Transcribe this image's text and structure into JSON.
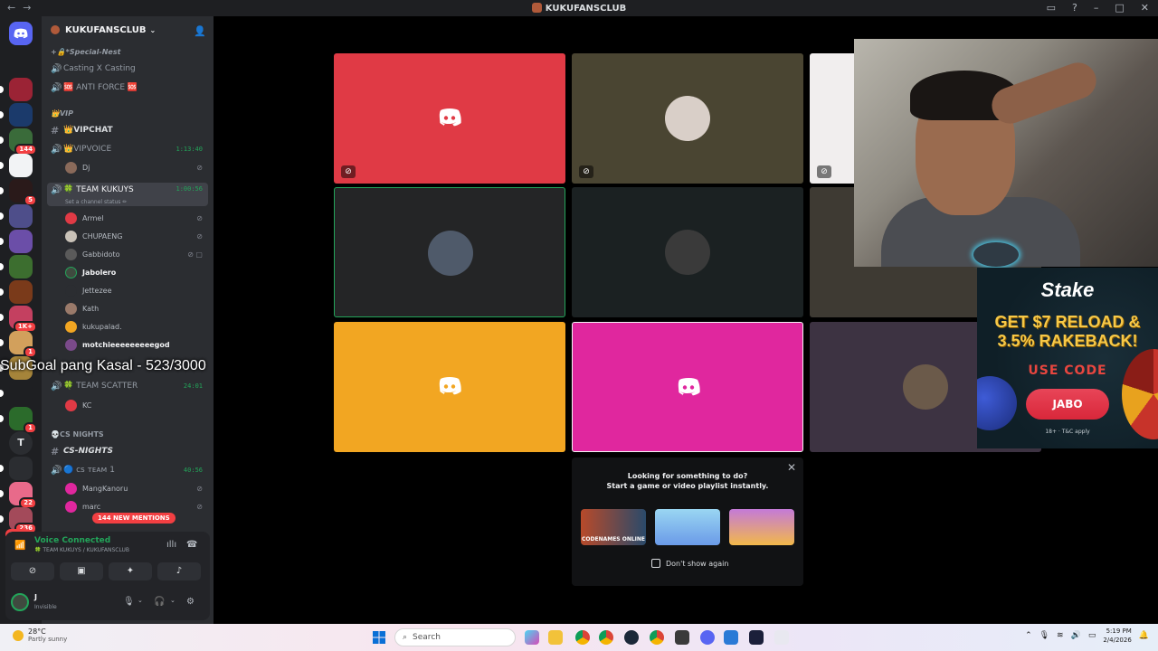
{
  "titlebar": {
    "title": "KUKUFANSCLUB",
    "back_glyph": "←",
    "forward_glyph": "→",
    "icons": [
      "inbox-icon",
      "help-icon",
      "minimize-icon",
      "maximize-icon",
      "close-icon"
    ]
  },
  "server_rail": {
    "servers": [
      {
        "color": "#5865f2",
        "badge": ""
      },
      {
        "color": "#9b2335",
        "badge": ""
      },
      {
        "color": "#1b3a6b",
        "badge": ""
      },
      {
        "color": "#3a6b3a",
        "badge": "144"
      },
      {
        "color": "#f2f3f5",
        "badge": ""
      },
      {
        "color": "#2a1a1a",
        "badge": "5"
      },
      {
        "color": "#4e4e8a",
        "badge": ""
      },
      {
        "color": "#6b4ea8",
        "badge": ""
      },
      {
        "color": "#3c6e2f",
        "badge": ""
      },
      {
        "color": "#7a3a1a",
        "badge": ""
      },
      {
        "color": "#c44060",
        "badge": "1K+"
      },
      {
        "color": "#d2a05c",
        "badge": "1"
      },
      {
        "color": "#a5843a",
        "badge": ""
      },
      {
        "color": "#1e1f22",
        "badge": ""
      },
      {
        "color": "#2b6b2b",
        "badge": "1"
      },
      {
        "color": "#2b2d31",
        "badge": ""
      },
      {
        "color": "#e86a8a",
        "badge": "22"
      },
      {
        "color": "#a34a5a",
        "badge": "236"
      }
    ],
    "letter_server": "T",
    "new_label": "NEW"
  },
  "guild": {
    "name": "KUKUFANSCLUB",
    "categories": {
      "special": "+🔒*Special-Nest",
      "vip": "👑VIP",
      "csnights": "💀CS NIGHTS"
    },
    "channels": {
      "casting": "Casting X Casting",
      "antiforce": "🆘 ANTI FORCE 🆘",
      "vipchat": "👑VIPCHAT",
      "vipvoice": "👑VIPVOICE",
      "vipvoice_time": "1:13:40",
      "teamkukuys": "🍀 TEAM KUKUYS",
      "teamkukuys_time": "1:00:56",
      "teamkukuys_status": "Set a channel status ✏",
      "teamscatter": "🍀 TEAM SCATTER",
      "teamscatter_time": "24:01",
      "csnights": "CS-NIGHTS",
      "csteam": "🔵 ᴄs ᴛᴇᴀᴍ 1",
      "csteam_time": "40:56"
    },
    "users": {
      "dj": "Dj",
      "armel": "Armel",
      "chupaeng": "CHUPAENG",
      "gabbidoto": "Gabbidoto",
      "jabolero": "Jabolero",
      "jettezee": "Jettezee",
      "kath": "Kath",
      "kukupalad": "kukupalad.",
      "motchie": "motchieeeeeeeeegod",
      "kc": "KC",
      "mangkanoru": "MangKanoru",
      "marc": "marc"
    },
    "mentions": "144 NEW MENTIONS"
  },
  "overlay_text": "SubGoal pang Kasal - 523/3000",
  "voice_panel": {
    "status": "Voice Connected",
    "channel": "🍀 TEAM KUKUYS / KUKUFANSCLUB",
    "user_name": "J",
    "user_status": "Invisible"
  },
  "activity": {
    "line1": "Looking for something to do?",
    "line2": "Start a game or video playlist instantly.",
    "games": [
      "CODENAMES ONLINE",
      "",
      ""
    ],
    "dont_show": "Don't show again"
  },
  "promo": {
    "brand": "Stake",
    "headline1": "GET $7 RELOAD &",
    "headline2": "3.5% RAKEBACK!",
    "use_code": "USE CODE",
    "code": "JABO",
    "terms": "18+ · T&C apply"
  },
  "taskbar": {
    "temp": "28°C",
    "weather": "Partly sunny",
    "search_placeholder": "Search",
    "time": "5:19 PM",
    "date": "2/4/2026"
  },
  "colors": {
    "tile_red": "#e03a45",
    "tile_olive": "#4a4532",
    "tile_dark1": "#242526",
    "tile_dark2": "#1b2122",
    "tile_brown": "#3e3a33",
    "tile_orange": "#f2a622",
    "tile_pink": "#e0279e",
    "tile_purple": "#3d3342",
    "tile_light": "#f1eeee",
    "speaking_green": "#23a55a"
  }
}
